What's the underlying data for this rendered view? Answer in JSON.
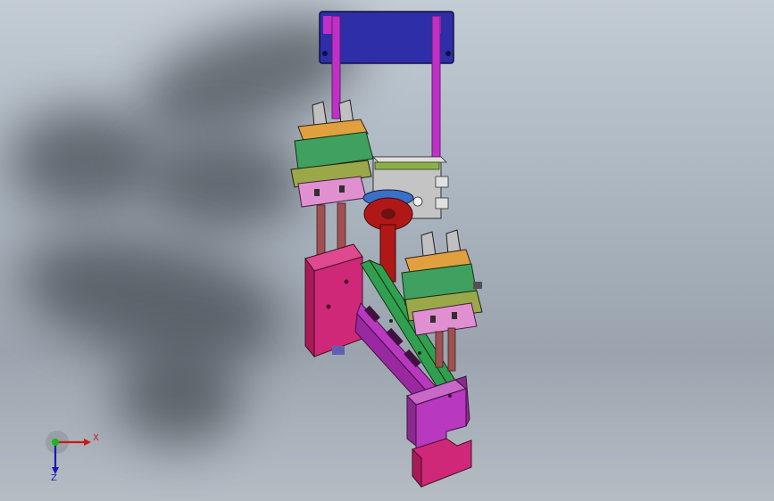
{
  "viewport": {
    "background_top": "#c3ccd5",
    "background_bottom": "#9ba4ae"
  },
  "triad": {
    "x_label": "X",
    "z_label": "Z",
    "x_color": "#d01818",
    "y_color": "#18b818",
    "z_color": "#1818b8"
  },
  "model": {
    "colors": {
      "mount_plate": "#2e2ea8",
      "rods": "#c030c8",
      "gripper_orange": "#e0a040",
      "gripper_green": "#3fa060",
      "gripper_pink": "#e090d0",
      "base_block": "#c8c8c8",
      "red_shaft": "#b01818",
      "blue_disk": "#3a70c8",
      "magenta_block": "#d02878",
      "green_plate": "#30a050",
      "purple_plate": "#b838c0"
    }
  }
}
